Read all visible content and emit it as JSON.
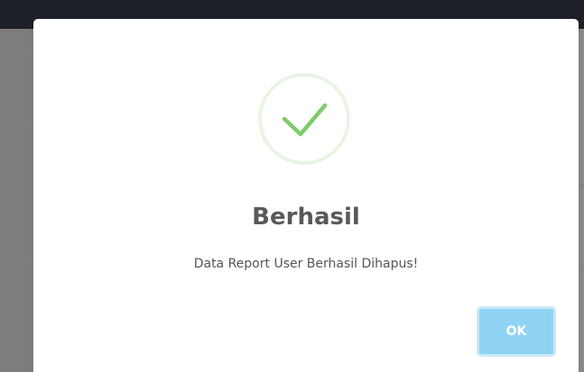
{
  "dialog": {
    "title": "Berhasil",
    "message": "Data Report User Berhasil Dihapus!",
    "confirm_label": "OK",
    "icon": "success-check-icon"
  },
  "colors": {
    "success": "#7ccc6b",
    "success_ring": "#e8f5e3",
    "confirm_button": "#8fd3f4",
    "topbar": "#1e2129",
    "overlay": "#8b8b8b"
  }
}
